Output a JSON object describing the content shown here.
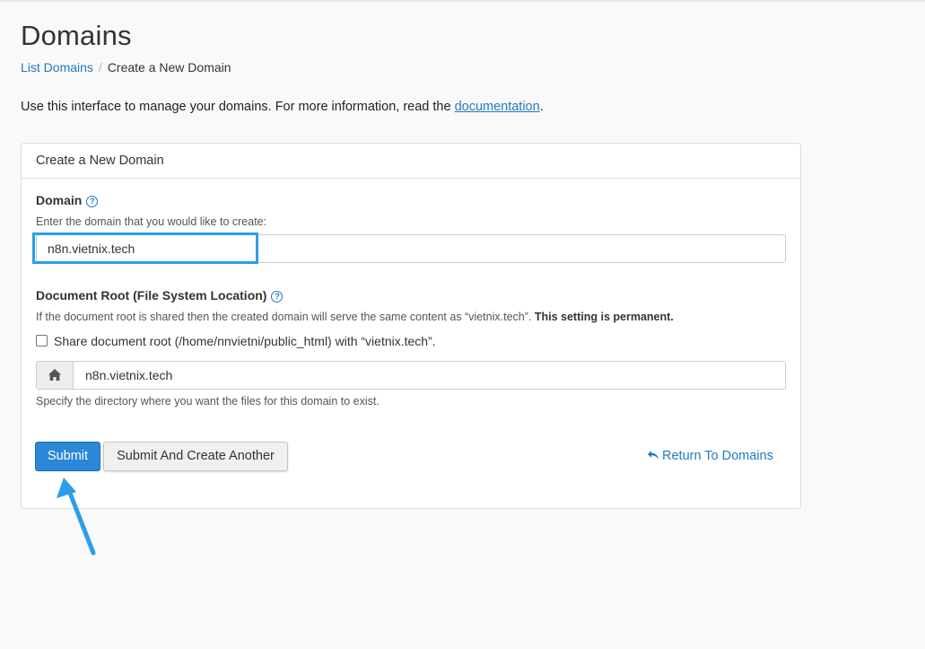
{
  "page": {
    "title": "Domains"
  },
  "breadcrumb": {
    "parent": "List Domains",
    "separator": "/",
    "current": "Create a New Domain"
  },
  "intro": {
    "text": "Use this interface to manage your domains. For more information, read the ",
    "link": "documentation",
    "suffix": "."
  },
  "panel": {
    "title": "Create a New Domain"
  },
  "domain": {
    "label": "Domain",
    "hint": "Enter the domain that you would like to create:",
    "value": "n8n.vietnix.tech"
  },
  "docroot": {
    "label": "Document Root (File System Location)",
    "hint": "If the document root is shared then the created domain will serve the same content as “vietnix.tech”.",
    "hint_bold": "This setting is permanent.",
    "share_label": "Share document root (/home/nnvietni/public_html) with “vietnix.tech”.",
    "value": "n8n.vietnix.tech",
    "help": "Specify the directory where you want the files for this domain to exist."
  },
  "actions": {
    "submit": "Submit",
    "submit_another": "Submit And Create Another",
    "return": "Return To Domains"
  },
  "icons": {
    "help": "question-circle-icon",
    "home": "home-icon",
    "return": "reply-icon"
  },
  "colors": {
    "accent": "#1f7ac2",
    "primary_button": "#2b88d8",
    "highlight": "#2c9ee8"
  }
}
